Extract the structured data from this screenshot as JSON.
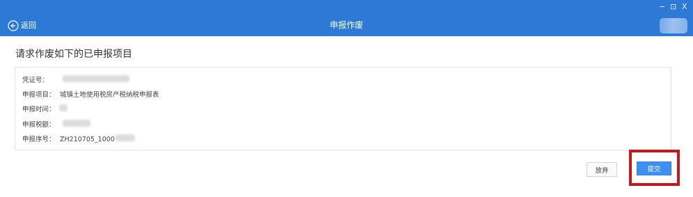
{
  "window": {
    "back_label": "返回",
    "title": "申报作废",
    "controls": {
      "minimize": "−",
      "restore": "⊡",
      "close": "X"
    }
  },
  "main": {
    "heading": "请求作废如下的已申报项目",
    "fields": [
      {
        "label": "凭证号：",
        "value": ""
      },
      {
        "label": "申报项目：",
        "value": "城镇土地使用税房产税纳税申报表"
      },
      {
        "label": "申报时间：",
        "value": ""
      },
      {
        "label": "申报税额：",
        "value": ""
      },
      {
        "label": "申报序号：",
        "value": "ZH210705_1000"
      }
    ]
  },
  "actions": {
    "abandon_label": "放弃",
    "submit_label": "提交"
  },
  "colors": {
    "titlebar": "#2d7ad6",
    "submit": "#3d8ff2",
    "highlight": "#c8161c"
  }
}
